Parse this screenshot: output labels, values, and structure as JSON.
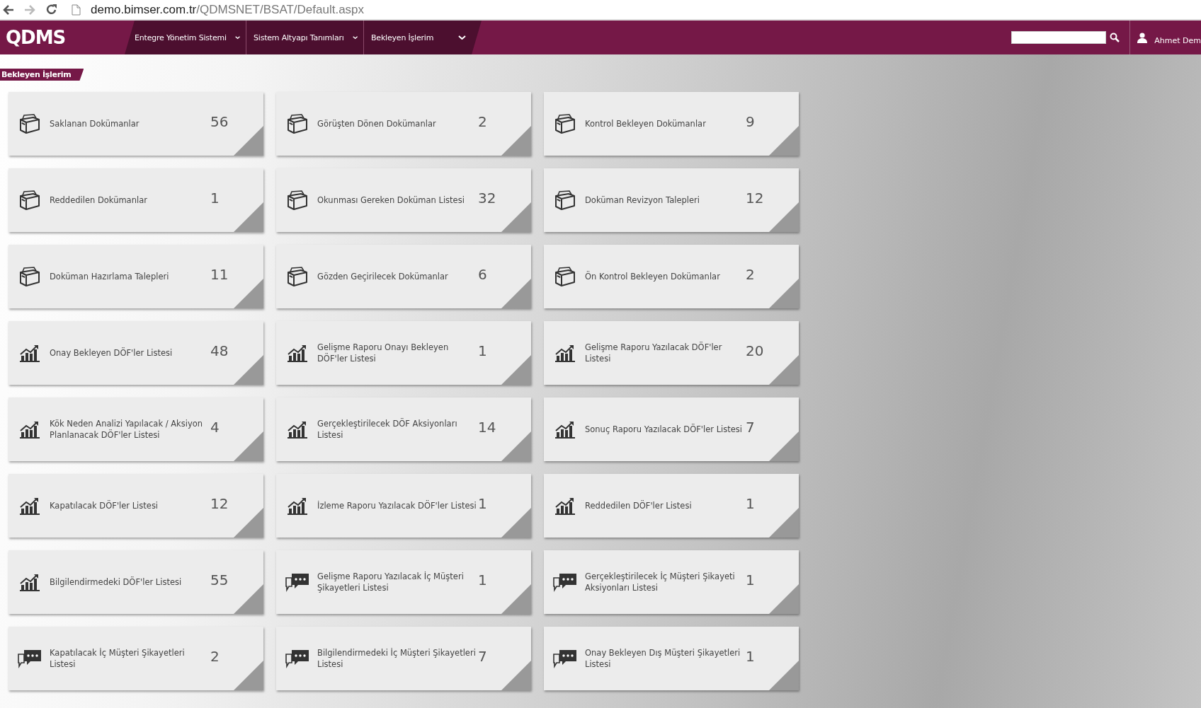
{
  "browser": {
    "url_host": "demo.bimser.com.tr",
    "url_path": "/QDMSNET/BSAT/Default.aspx"
  },
  "navbar": {
    "logo": "QDMS",
    "menu": [
      {
        "label": "Entegre Yönetim Sistemi"
      },
      {
        "label": "Sistem Altyapı Tanımları"
      },
      {
        "label": "Bekleyen İşlerim"
      }
    ],
    "user": "Ahmet Dem"
  },
  "breadcrumb": "Bekleyen İşlerim",
  "cards": [
    {
      "kind": "document",
      "label": "Saklanan Dokümanlar",
      "count": "56"
    },
    {
      "kind": "document",
      "label": "Görüşten Dönen Dokümanlar",
      "count": "2"
    },
    {
      "kind": "document",
      "label": "Kontrol Bekleyen Dokümanlar",
      "count": "9"
    },
    {
      "kind": "document",
      "label": "Reddedilen Dokümanlar",
      "count": "1"
    },
    {
      "kind": "document",
      "label": "Okunması Gereken Doküman Listesi",
      "count": "32"
    },
    {
      "kind": "document",
      "label": "Doküman Revizyon Talepleri",
      "count": "12"
    },
    {
      "kind": "document",
      "label": "Doküman Hazırlama Talepleri",
      "count": "11"
    },
    {
      "kind": "document",
      "label": "Gözden Geçirilecek Dokümanlar",
      "count": "6"
    },
    {
      "kind": "document",
      "label": "Ön Kontrol Bekleyen Dokümanlar",
      "count": "2"
    },
    {
      "kind": "action",
      "label": "Onay Bekleyen DÖF'ler Listesi",
      "count": "48"
    },
    {
      "kind": "action",
      "label": "Gelişme Raporu Onayı Bekleyen DÖF'ler Listesi",
      "count": "1"
    },
    {
      "kind": "action",
      "label": "Gelişme Raporu Yazılacak DÖF'ler Listesi",
      "count": "20"
    },
    {
      "kind": "action",
      "label": "Kök Neden Analizi Yapılacak / Aksiyon Planlanacak DÖF'ler Listesi",
      "count": "4"
    },
    {
      "kind": "action",
      "label": "Gerçekleştirilecek DÖF Aksiyonları Listesi",
      "count": "14"
    },
    {
      "kind": "action",
      "label": "Sonuç Raporu Yazılacak DÖF'ler Listesi",
      "count": "7"
    },
    {
      "kind": "action",
      "label": "Kapatılacak DÖF'ler Listesi",
      "count": "12"
    },
    {
      "kind": "action",
      "label": "İzleme Raporu Yazılacak DÖF'ler Listesi",
      "count": "1"
    },
    {
      "kind": "action",
      "label": "Reddedilen DÖF'ler Listesi",
      "count": "1"
    },
    {
      "kind": "action",
      "label": "Bilgilendirmedeki DÖF'ler Listesi",
      "count": "55"
    },
    {
      "kind": "complaint",
      "label": "Gelişme Raporu Yazılacak İç Müşteri Şikayetleri Listesi",
      "count": "1"
    },
    {
      "kind": "complaint",
      "label": "Gerçekleştirilecek İç Müşteri Şikayeti Aksiyonları Listesi",
      "count": "1"
    },
    {
      "kind": "complaint",
      "label": "Kapatılacak İç Müşteri Şikayetleri Listesi",
      "count": "2"
    },
    {
      "kind": "complaint",
      "label": "Bilgilendirmedeki İç Müşteri Şikayetleri Listesi",
      "count": "7"
    },
    {
      "kind": "complaint",
      "label": "Onay Bekleyen Dış Müşteri Şikayetleri Listesi",
      "count": "1"
    }
  ]
}
